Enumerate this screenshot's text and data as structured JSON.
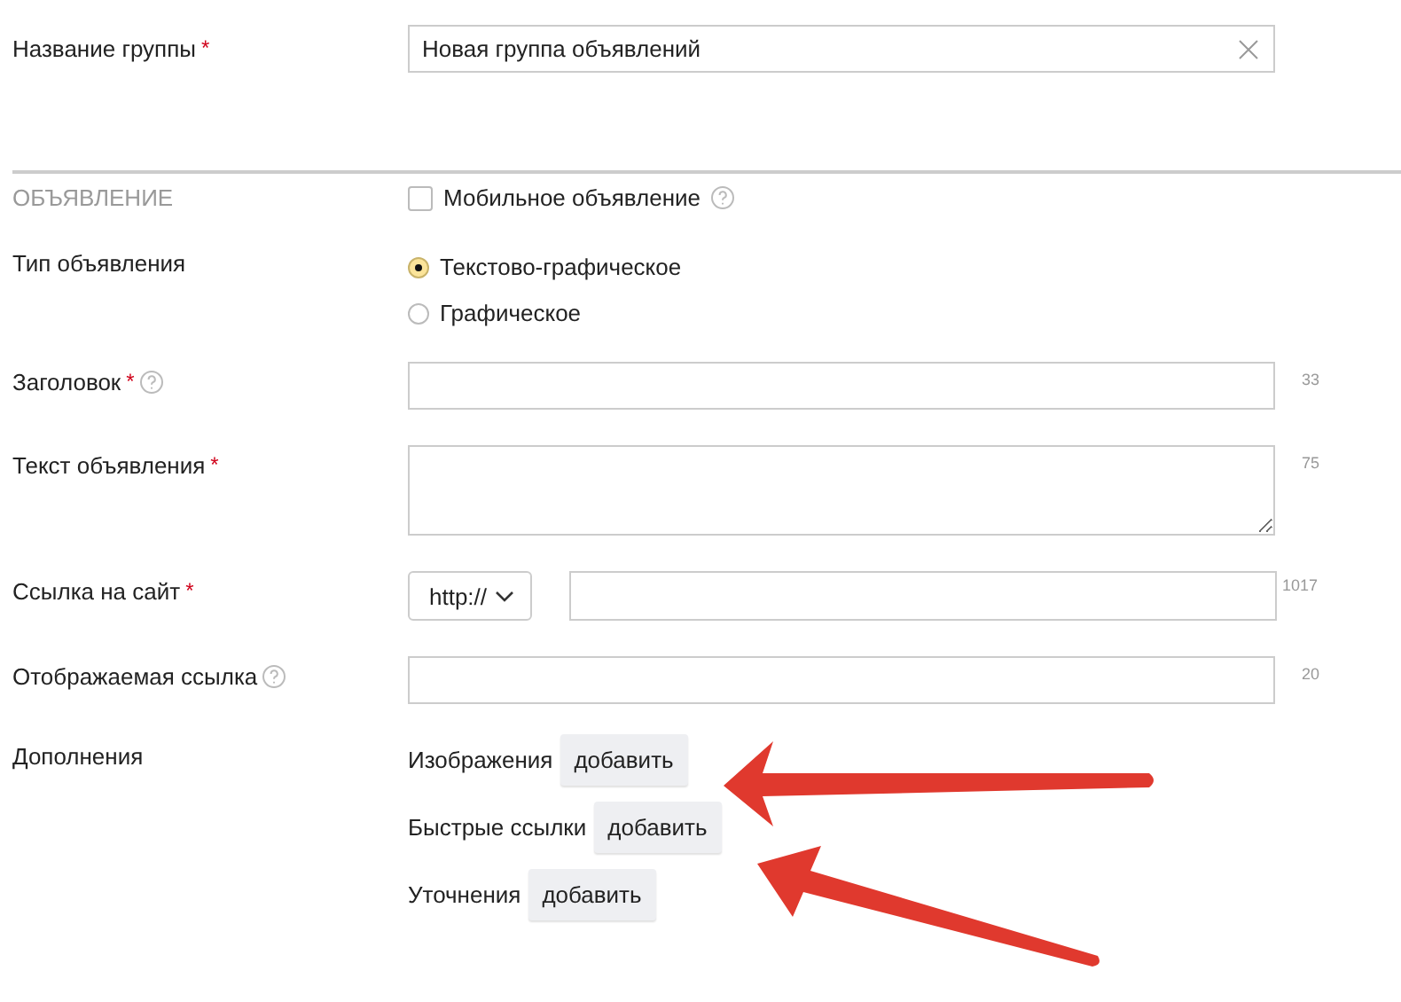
{
  "group_name": {
    "label": "Название группы",
    "required_mark": "*",
    "value": "Новая группа объявлений"
  },
  "section": {
    "title": "ОБЪЯВЛЕНИЕ",
    "mobile": {
      "label": "Мобильное объявление",
      "checked": false,
      "help": true
    }
  },
  "ad_type": {
    "label": "Тип объявления",
    "options": [
      {
        "label": "Текстово-графическое",
        "selected": true
      },
      {
        "label": "Графическое",
        "selected": false
      }
    ]
  },
  "fields": [
    {
      "kind": "input",
      "label": "Заголовок",
      "required_mark": "*",
      "help": true,
      "counter": "33"
    },
    {
      "kind": "textarea",
      "label": "Текст объявления",
      "required_mark": "*",
      "help": false,
      "counter": "75"
    },
    {
      "kind": "url",
      "label": "Ссылка на сайт",
      "required_mark": "*",
      "help": false,
      "protocol": "http://",
      "counter": "1017"
    },
    {
      "kind": "input",
      "label": "Отображаемая ссылка",
      "help": true,
      "counter": "20"
    }
  ],
  "additions": {
    "label": "Дополнения",
    "items": [
      {
        "label": "Изображения",
        "button": "добавить"
      },
      {
        "label": "Быстрые ссылки",
        "button": "добавить"
      },
      {
        "label": "Уточнения",
        "button": "добавить"
      }
    ]
  }
}
